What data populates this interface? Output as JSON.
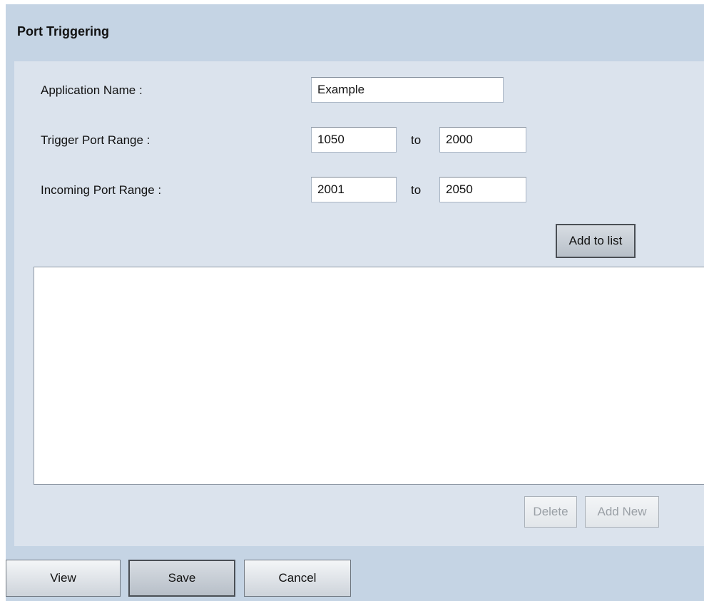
{
  "page": {
    "title": "Port Triggering"
  },
  "form": {
    "application_name_label": "Application Name :",
    "application_name_value": "Example",
    "trigger_label": "Trigger Port Range :",
    "trigger_start": "1050",
    "trigger_end": "2000",
    "incoming_label": "Incoming Port Range :",
    "incoming_start": "2001",
    "incoming_end": "2050",
    "to_text": "to",
    "add_to_list_label": "Add to list"
  },
  "list": {
    "entries": [],
    "delete_label": "Delete",
    "add_new_label": "Add New"
  },
  "footer": {
    "view_label": "View",
    "save_label": "Save",
    "cancel_label": "Cancel"
  },
  "colors": {
    "frame_bg": "#c5d4e4",
    "panel_bg": "#dbe3ed"
  }
}
